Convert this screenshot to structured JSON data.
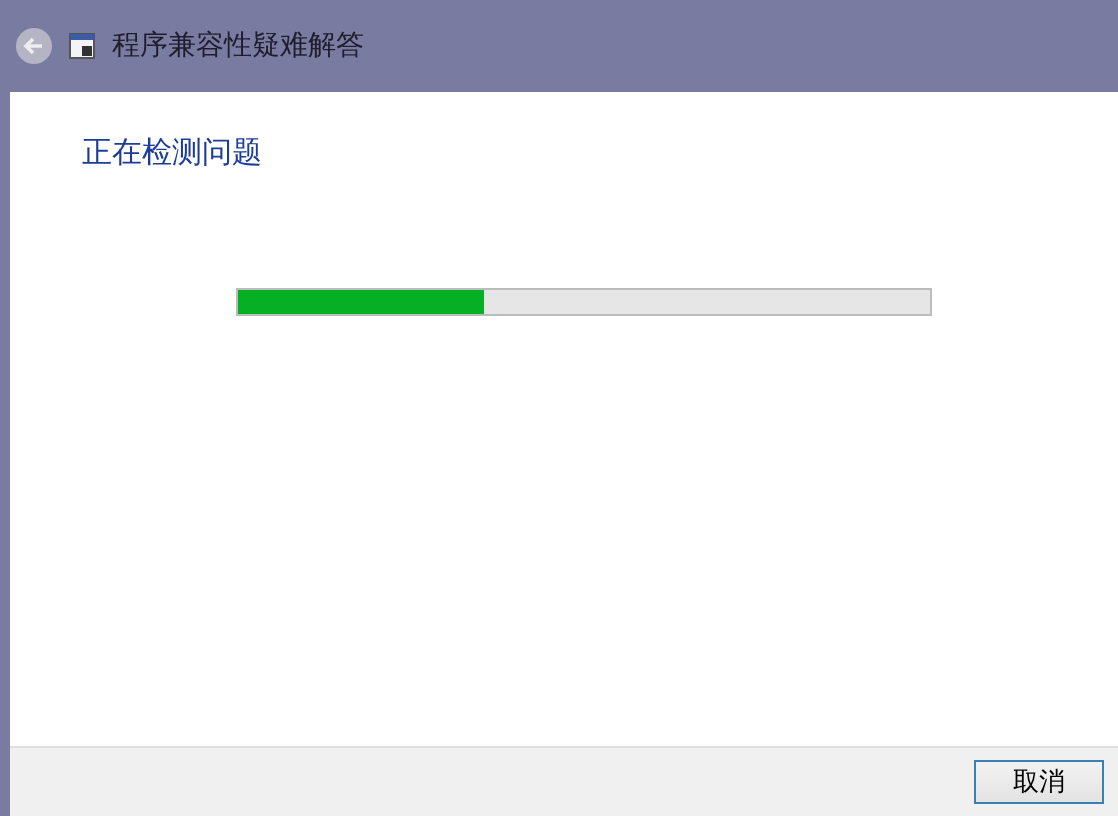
{
  "window": {
    "title": "程序兼容性疑难解答"
  },
  "heading": "正在检测问题",
  "progress": {
    "level": 0.355
  },
  "buttons": [
    "取消"
  ]
}
